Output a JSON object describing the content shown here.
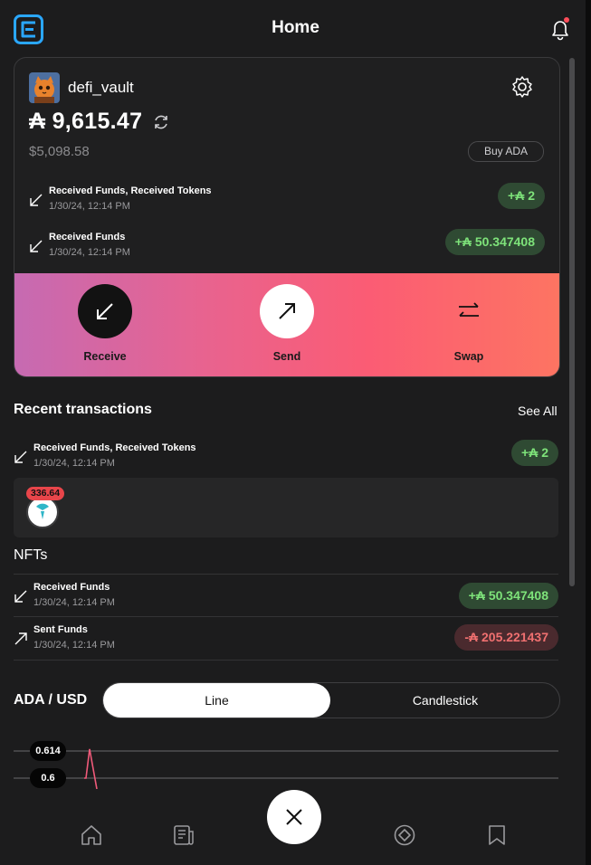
{
  "header": {
    "title": "Home"
  },
  "wallet": {
    "name": "defi_vault",
    "balance": "₳ 9,615.47",
    "fiat": "$5,098.58",
    "buy_label": "Buy ADA",
    "transactions": [
      {
        "title": "Received Funds, Received Tokens",
        "time": "1/30/24, 12:14 PM",
        "amount": "+₳ 2",
        "direction": "in"
      },
      {
        "title": "Received Funds",
        "time": "1/30/24, 12:14 PM",
        "amount": "+₳ 50.347408",
        "direction": "in"
      }
    ]
  },
  "actions": [
    {
      "label": "Receive"
    },
    {
      "label": "Send"
    },
    {
      "label": "Swap"
    }
  ],
  "recent": {
    "title": "Recent transactions",
    "see_all": "See All",
    "items": [
      {
        "title": "Received Funds, Received Tokens",
        "time": "1/30/24, 12:14 PM",
        "amount": "+₳ 2"
      },
      {
        "title": "Received Funds",
        "time": "1/30/24, 12:14 PM",
        "amount": "+₳ 50.347408"
      },
      {
        "title": "Sent Funds",
        "time": "1/30/24, 12:14 PM",
        "amount": "-₳ 205.221437"
      }
    ],
    "token_badge": "336.64",
    "nfts_label": "NFTs"
  },
  "price": {
    "pair": "ADA / USD",
    "tabs": [
      "Line",
      "Candlestick"
    ],
    "selected_tab": "Line"
  },
  "chart_data": {
    "type": "line",
    "tick_labels": [
      "0.614",
      "0.6"
    ],
    "series": [
      {
        "values": [
          0.6,
          0.6,
          0.615,
          0.598
        ]
      }
    ]
  },
  "colors": {
    "positive": "#7ee37a",
    "negative": "#f07070",
    "accent": "#2aa7ff"
  }
}
